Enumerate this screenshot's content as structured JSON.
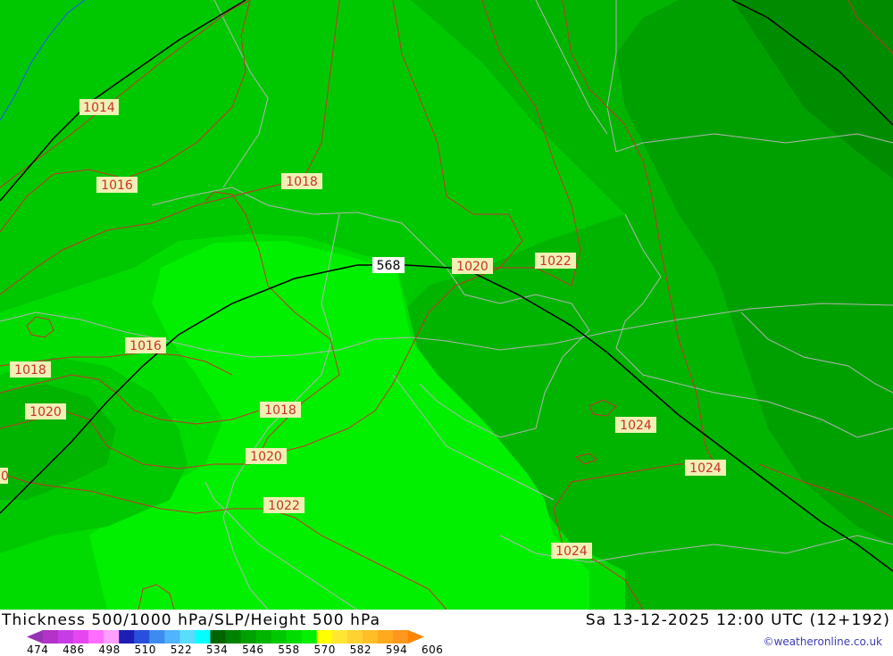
{
  "map": {
    "isobar_labels": [
      "1014",
      "1016",
      "1018",
      "1020",
      "1022",
      "1016",
      "1018",
      "1020",
      "1018",
      "1020",
      "1022",
      "1024",
      "1024",
      "1024",
      "1020",
      "0"
    ],
    "height_label": "568",
    "colors": {
      "band_546": "#00b400",
      "band_552": "#00c800",
      "band_558": "#00dc00",
      "band_564": "#00f000",
      "thickness_contour": "#8c8c8c",
      "isobar": "#c8322d",
      "height_contour": "#000000",
      "border": "#b4b4b4",
      "river": "#2850ff",
      "label_bg": "#f0f0b4"
    }
  },
  "footer": {
    "title": "Thickness 500/1000 hPa/SLP/Height 500 hPa",
    "timestamp": "Sa 13-12-2025 12:00 UTC (12+192)",
    "credit": "©weatheronline.co.uk",
    "scale_ticks": [
      "474",
      "486",
      "498",
      "510",
      "522",
      "534",
      "546",
      "558",
      "570",
      "582",
      "594",
      "606"
    ],
    "scale_colors": [
      "#9632b4",
      "#b432c8",
      "#c83ce6",
      "#e646f0",
      "#ff6eff",
      "#ffa0ff",
      "#1e1eb4",
      "#2850dc",
      "#3c8cf0",
      "#50b4ff",
      "#5adcff",
      "#00ffff",
      "#006400",
      "#008200",
      "#00a000",
      "#00b400",
      "#00c800",
      "#00dc00",
      "#00f000",
      "#ffff00",
      "#ffe632",
      "#ffd232",
      "#ffbe28",
      "#ffaa1e",
      "#ff961e",
      "#ff8200"
    ]
  }
}
